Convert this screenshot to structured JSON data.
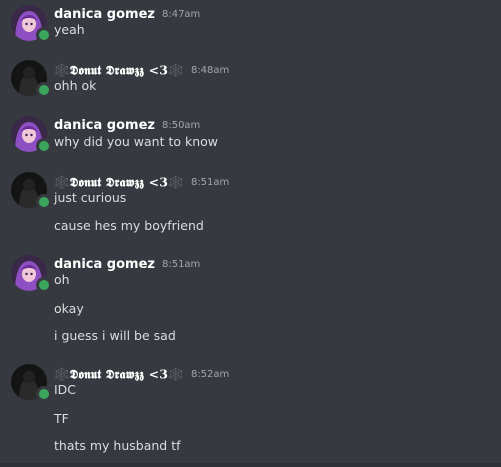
{
  "colors": {
    "background": "#36393f",
    "username": "#ffffff",
    "timestamp": "#a3a6aa",
    "message_text": "#dcddde",
    "online_status": "#3ba55c"
  },
  "users": {
    "danica": {
      "name": "danica gomez",
      "avatar_icon": "purple-anime-avatar-icon"
    },
    "donut": {
      "name": "🕸️𝕯𝖔𝖓𝖚𝖙 𝕯𝖗𝖆𝖜𝖟𝖟 <3🕸️",
      "avatar_icon": "dark-avatar-icon"
    }
  },
  "messages": [
    {
      "author": "danica gomez",
      "time": "8:47am",
      "lines": [
        "yeah"
      ]
    },
    {
      "author": "🕸️𝕯𝖔𝖓𝖚𝖙 𝕯𝖗𝖆𝖜𝖟𝖟 <3🕸️",
      "time": "8:48am",
      "lines": [
        "ohh ok"
      ]
    },
    {
      "author": "danica gomez",
      "time": "8:50am",
      "lines": [
        "why did you want to know"
      ]
    },
    {
      "author": "🕸️𝕯𝖔𝖓𝖚𝖙 𝕯𝖗𝖆𝖜𝖟𝖟 <3🕸️",
      "time": "8:51am",
      "lines": [
        "just curious",
        "cause hes my boyfriend"
      ]
    },
    {
      "author": "danica gomez",
      "time": "8:51am",
      "lines": [
        "oh",
        "okay",
        "i guess i will be sad"
      ]
    },
    {
      "author": "🕸️𝕯𝖔𝖓𝖚𝖙 𝕯𝖗𝖆𝖜𝖟𝖟 <3🕸️",
      "time": "8:52am",
      "lines": [
        "IDC",
        "TF",
        "thats my husband tf"
      ]
    }
  ]
}
